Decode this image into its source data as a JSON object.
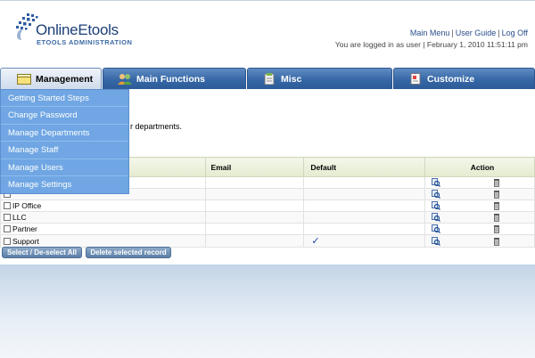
{
  "header": {
    "logo_title": "OnlineEtools",
    "logo_subtitle": "ETOOLS ADMINISTRATION",
    "links": [
      "Main Menu",
      "User Guide",
      "Log Off"
    ],
    "login_info": "You are logged in as user | February 1, 2010 11:51:11 pm"
  },
  "tabs": [
    {
      "label": "Management",
      "active": true
    },
    {
      "label": "Main Functions",
      "active": false
    },
    {
      "label": "Misc",
      "active": false
    },
    {
      "label": "Customize",
      "active": false
    }
  ],
  "dropdown": {
    "items": [
      "Getting Started Steps",
      "Change Password",
      "Manage Departments",
      "Manage Staff",
      "Manage Users",
      "Manage Settings"
    ]
  },
  "content": {
    "description_fragment": "r departments."
  },
  "table": {
    "columns": [
      "Email",
      "Default",
      "Action"
    ],
    "rows": [
      {
        "name": "",
        "email": "",
        "default": ""
      },
      {
        "name": "",
        "email": "",
        "default": ""
      },
      {
        "name": "IP Office",
        "email": "",
        "default": ""
      },
      {
        "name": "LLC",
        "email": "",
        "default": ""
      },
      {
        "name": "Partner",
        "email": "",
        "default": ""
      },
      {
        "name": "Support",
        "email": "",
        "default": "✓"
      }
    ]
  },
  "buttons": {
    "select_all": "Select / De-select All",
    "delete_selected": "Delete selected record"
  },
  "colors": {
    "tab_blue": "#3667a6",
    "dropdown_blue": "#6fa6e3",
    "header_green": "#e3ebcf",
    "link_blue": "#2a4e8c"
  },
  "icons": {
    "edit": "edit-magnifier-icon",
    "delete": "trash-icon",
    "management_tab": "folder-icon",
    "main_functions_tab": "users-icon",
    "misc_tab": "clipboard-icon",
    "customize_tab": "document-icon"
  }
}
